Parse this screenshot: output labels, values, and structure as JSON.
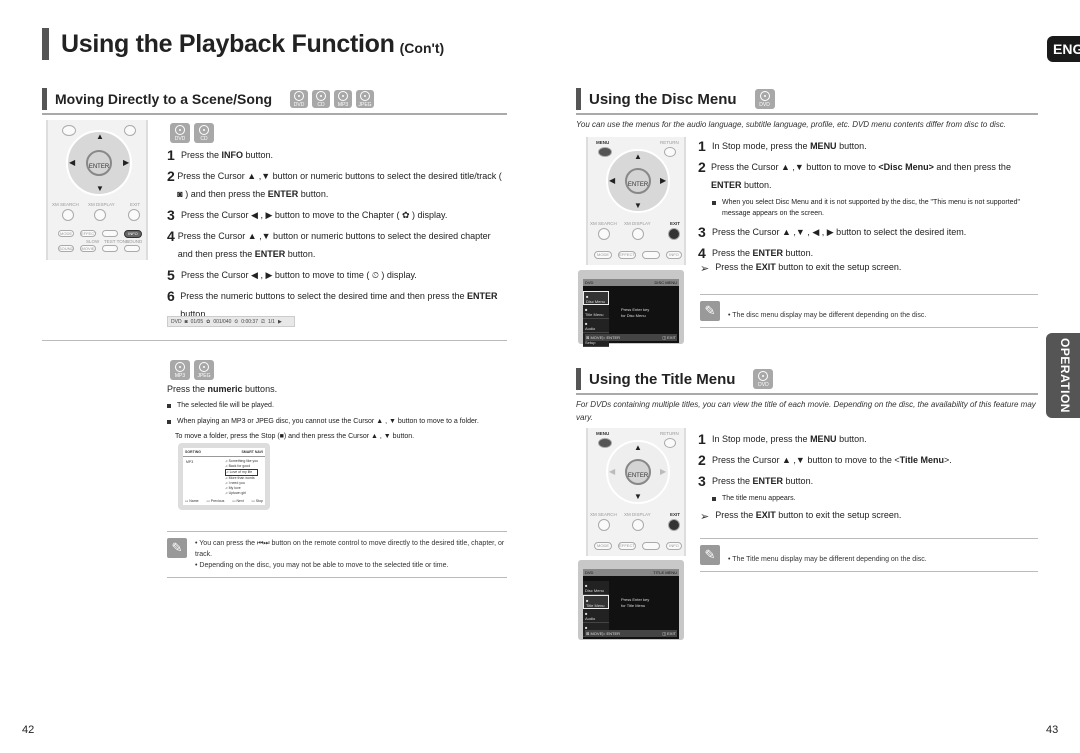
{
  "header": {
    "title": "Using the Playback Function",
    "subtitle": "(Con't)",
    "lang_badge": "ENG",
    "side_tab": "OPERATION"
  },
  "left": {
    "section_title": "Moving Directly to a Scene/Song",
    "section_discs": [
      "DVD",
      "CD",
      "MP3",
      "JPEG"
    ],
    "group1_discs": [
      "DVD",
      "CD"
    ],
    "steps": [
      {
        "n": "1",
        "html": "Press the <b>INFO</b> button."
      },
      {
        "n": "2",
        "html": "Press the Cursor ▲ ,▼ button or numeric buttons to select the desired title/track ( ◙ )  and then press the <b>ENTER</b> button."
      },
      {
        "n": "3",
        "html": "Press the Cursor ◀ , ▶ button to move to the Chapter ( ✿ ) display."
      },
      {
        "n": "4",
        "html": "Press the Cursor ▲ ,▼ button or numeric buttons to select the desired chapter and then press the <b>ENTER</b> button."
      },
      {
        "n": "5",
        "html": "Press the Cursor ◀ , ▶ button to move to time ( ⏲ ) display."
      },
      {
        "n": "6",
        "html": "Press the numeric buttons to select the desired time and then press the <b>ENTER</b> button."
      }
    ],
    "info_bar": {
      "disc": "DVD",
      "title": "01/05",
      "chapter": "001/040",
      "time": "0:00:37",
      "angle": "1/1"
    },
    "group2_discs": [
      "MP3",
      "JPEG"
    ],
    "numeric_intro_pre": "Press the ",
    "numeric_intro_bold": "numeric",
    "numeric_intro_post": " buttons.",
    "bullets": [
      "The selected file will be played.",
      "When playing an MP3 or JPEG disc, you cannot use the Cursor ▲ , ▼ button to move to a folder."
    ],
    "bullet_cont": "To move a folder, press the Stop (■) and then press the Cursor ▲ , ▼ button.",
    "file_screen": {
      "header": "SORTING",
      "smart_nav": "SMART NAVI",
      "folder": "MP3",
      "tracks": [
        "Something like you",
        "Back for good",
        "Love of my life",
        "More than words",
        "I need you",
        "My love",
        "Uptown girl"
      ],
      "footer": [
        "Name",
        "Previous",
        "Next",
        "Stop"
      ]
    },
    "notes": [
      "• You can press the ⏮⏭ button on the remote control to move directly to the desired title, chapter, or track.",
      "• Depending on the disc, you may not be able to move to the selected title or time."
    ],
    "remote": {
      "enter": "ENTER",
      "xm_search": "XM SEARCH",
      "xm_display": "XM DISPLAY",
      "exit": "EXIT",
      "info": "INFO",
      "mode": "MODE",
      "effect": "EFFECT",
      "sound": "SOUND",
      "movie": "MOVIE",
      "slow": "SLOW",
      "test_tone": "TEST TONE",
      "sound_edit": "SOUND EDIT"
    },
    "page_number": "42"
  },
  "right": {
    "disc_menu": {
      "title": "Using the Disc Menu",
      "disc": "DVD",
      "intro": "You can use the menus for the audio language, subtitle language, profile, etc. DVD menu contents differ from disc to disc.",
      "steps": [
        {
          "n": "1",
          "html": "In Stop mode, press the <b>MENU</b> button."
        },
        {
          "n": "2",
          "html": "Press the Cursor ▲ ,▼ button to move to <b>&lt;Disc Menu&gt;</b> and then press the <b>ENTER</b> button."
        },
        {
          "n": "3",
          "html": "Press the Cursor ▲ ,▼ , ◀ , ▶ button to select the desired item."
        },
        {
          "n": "4",
          "html": "Press the <b>ENTER</b> button."
        }
      ],
      "step2_bullet": "When you select Disc Menu and it is not supported by the disc, the \"This menu is not supported\" message appears on the screen.",
      "tip": "Press the <b>EXIT</b> button to exit the setup screen.",
      "note": "• The disc menu display may be different depending on the disc.",
      "screen": {
        "top_left": "DVD",
        "top_right": "DISC MENU",
        "items": [
          "Disc Menu",
          "Title Menu",
          "Audio",
          "Setup"
        ],
        "message": [
          "Press Enter key",
          "for Disc Menu"
        ],
        "footer": [
          "MOVE",
          "ENTER",
          "EXIT"
        ]
      }
    },
    "title_menu": {
      "title": "Using the Title Menu",
      "disc": "DVD",
      "intro": "For DVDs containing multiple titles, you can view the title of each movie. Depending on the disc, the availability of this feature may vary.",
      "steps": [
        {
          "n": "1",
          "html": "In Stop mode, press the <b>MENU</b> button."
        },
        {
          "n": "2",
          "html": "Press the Cursor ▲ ,▼ button to move to the &lt;<b>Title Menu</b>&gt;."
        },
        {
          "n": "3",
          "html": "Press the <b>ENTER</b> button."
        }
      ],
      "step3_bullet": "The title menu appears.",
      "tip": "Press the <b>EXIT</b> button to exit the setup screen.",
      "note": "• The Title menu display may be different depending on the disc.",
      "screen": {
        "top_left": "DVD",
        "top_right": "TITLE MENU",
        "items": [
          "Disc Menu",
          "Title Menu",
          "Audio",
          "Setup"
        ],
        "message": [
          "Press Enter key",
          "for Title Menu"
        ],
        "footer": [
          "MOVE",
          "ENTER",
          "EXIT"
        ]
      }
    },
    "remote": {
      "menu": "MENU",
      "return": "RETURN",
      "enter": "ENTER",
      "xm_search": "XM SEARCH",
      "xm_display": "XM DISPLAY",
      "exit": "EXIT",
      "mode": "MODE",
      "effect": "EFFECT",
      "info": "INFO"
    },
    "page_number": "43"
  }
}
